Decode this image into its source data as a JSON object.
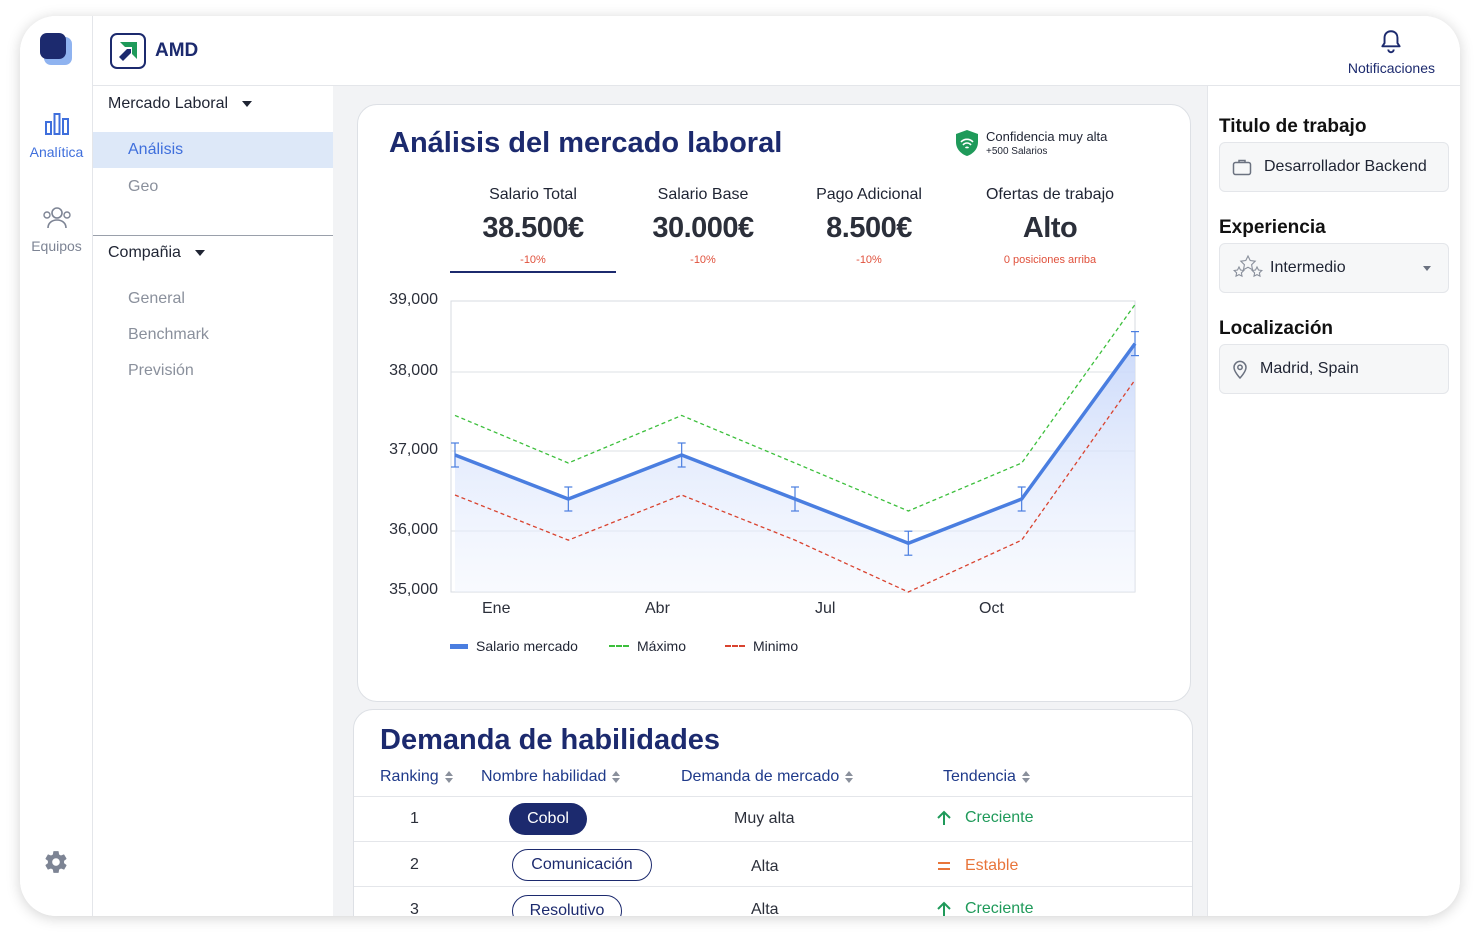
{
  "brand": {
    "name": "AMD"
  },
  "rail": {
    "items": [
      {
        "label": "Analítica",
        "icon": "bar-chart-icon"
      },
      {
        "label": "Equipos",
        "icon": "users-icon"
      }
    ]
  },
  "header": {
    "notifications_label": "Notificaciones"
  },
  "nav": {
    "section1": {
      "label": "Mercado Laboral",
      "items": [
        "Análisis",
        "Geo"
      ]
    },
    "section2": {
      "label": "Compañia",
      "items": [
        "General",
        "Benchmark",
        "Previsión"
      ]
    }
  },
  "analysis": {
    "title": "Análisis del mercado laboral",
    "confidence": {
      "label": "Confidencia muy alta",
      "sub": "+500 Salarios"
    },
    "kpis": [
      {
        "label": "Salario Total",
        "value": "38.500€",
        "change": "-10%"
      },
      {
        "label": "Salario Base",
        "value": "30.000€",
        "change": "-10%"
      },
      {
        "label": "Pago Adicional",
        "value": "8.500€",
        "change": "-10%"
      },
      {
        "label": "Ofertas de trabajo",
        "value": "Alto",
        "change": "0 posiciones  arriba"
      }
    ]
  },
  "chart_data": {
    "type": "line",
    "x_ticks": [
      "Ene",
      "Abr",
      "Jul",
      "Oct"
    ],
    "y_ticks": [
      "39,000",
      "38,000",
      "37,000",
      "36,000",
      "35,000"
    ],
    "ylim": [
      35000,
      39000
    ],
    "x": [
      0,
      1,
      2,
      3,
      4,
      5,
      6
    ],
    "series": [
      {
        "name": "Salario mercado",
        "color": "#4a7ee0",
        "values": [
          36950,
          36400,
          36950,
          36400,
          35800,
          36400,
          38400
        ]
      },
      {
        "name": "Máximo",
        "color": "#3cbf3c",
        "values": [
          37450,
          36850,
          37450,
          36850,
          36250,
          36850,
          38950
        ]
      },
      {
        "name": "Minimo",
        "color": "#d9432f",
        "values": [
          36450,
          35850,
          36450,
          35850,
          35000,
          35850,
          37900
        ]
      }
    ],
    "grid": true,
    "legend": "bottom-left"
  },
  "skills": {
    "title": "Demanda de habilidades",
    "columns": [
      "Ranking",
      "Nombre habilidad",
      "Demanda de mercado",
      "Tendencia"
    ],
    "rows": [
      {
        "rank": "1",
        "skill": "Cobol",
        "demand": "Muy alta",
        "trend": "Creciente",
        "trend_icon": "arrow-up-icon",
        "trend_color": "#1f9a5a"
      },
      {
        "rank": "2",
        "skill": "Comunicación",
        "demand": "Alta",
        "trend": "Estable",
        "trend_icon": "equals-icon",
        "trend_color": "#e8753a"
      },
      {
        "rank": "3",
        "skill": "Resolutivo",
        "demand": "Alta",
        "trend": "Creciente",
        "trend_icon": "arrow-up-icon",
        "trend_color": "#1f9a5a"
      }
    ]
  },
  "filters": {
    "job_title": {
      "label": "Titulo de trabajo",
      "value": "Desarrollador Backend"
    },
    "experience": {
      "label": "Experiencia",
      "value": "Intermedio"
    },
    "location": {
      "label": "Localización",
      "value": "Madrid, Spain"
    }
  }
}
